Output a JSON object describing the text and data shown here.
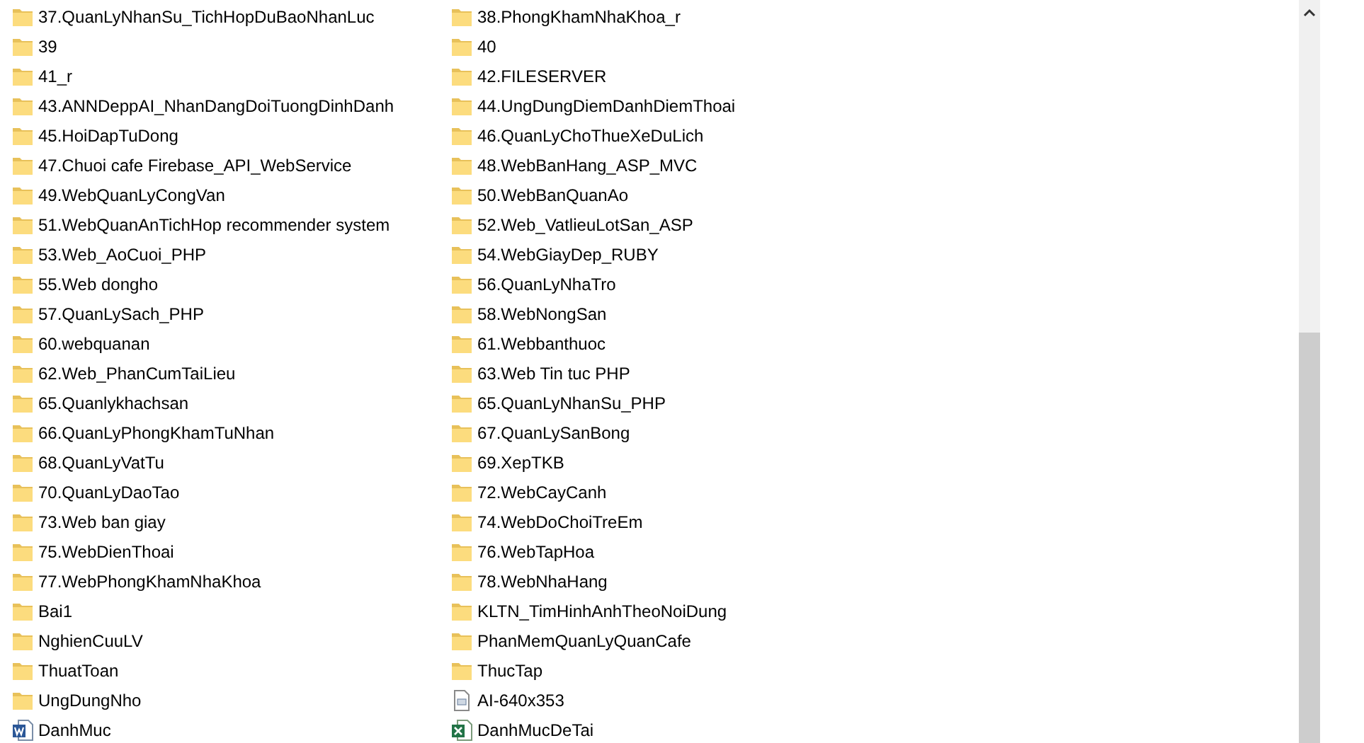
{
  "file_list": [
    {
      "name": "37.QuanLyNhanSu_TichHopDuBaoNhanLuc",
      "kind": "folder"
    },
    {
      "name": "38.PhongKhamNhaKhoa_r",
      "kind": "folder"
    },
    {
      "name": "39",
      "kind": "folder"
    },
    {
      "name": "40",
      "kind": "folder"
    },
    {
      "name": "41_r",
      "kind": "folder"
    },
    {
      "name": "42.FILESERVER",
      "kind": "folder"
    },
    {
      "name": "43.ANNDeppAI_NhanDangDoiTuongDinhDanh",
      "kind": "folder"
    },
    {
      "name": "44.UngDungDiemDanhDiemThoai",
      "kind": "folder"
    },
    {
      "name": "45.HoiDapTuDong",
      "kind": "folder"
    },
    {
      "name": "46.QuanLyChoThueXeDuLich",
      "kind": "folder"
    },
    {
      "name": "47.Chuoi cafe Firebase_API_WebService",
      "kind": "folder"
    },
    {
      "name": "48.WebBanHang_ASP_MVC",
      "kind": "folder"
    },
    {
      "name": "49.WebQuanLyCongVan",
      "kind": "folder"
    },
    {
      "name": "50.WebBanQuanAo",
      "kind": "folder"
    },
    {
      "name": "51.WebQuanAnTichHop recommender system",
      "kind": "folder"
    },
    {
      "name": "52.Web_VatlieuLotSan_ASP",
      "kind": "folder"
    },
    {
      "name": "53.Web_AoCuoi_PHP",
      "kind": "folder"
    },
    {
      "name": "54.WebGiayDep_RUBY",
      "kind": "folder"
    },
    {
      "name": "55.Web dongho",
      "kind": "folder"
    },
    {
      "name": "56.QuanLyNhaTro",
      "kind": "folder"
    },
    {
      "name": "57.QuanLySach_PHP",
      "kind": "folder"
    },
    {
      "name": "58.WebNongSan",
      "kind": "folder"
    },
    {
      "name": "60.webquanan",
      "kind": "folder"
    },
    {
      "name": "61.Webbanthuoc",
      "kind": "folder"
    },
    {
      "name": "62.Web_PhanCumTaiLieu",
      "kind": "folder"
    },
    {
      "name": "63.Web Tin tuc PHP",
      "kind": "folder"
    },
    {
      "name": "65.Quanlykhachsan",
      "kind": "folder"
    },
    {
      "name": "65.QuanLyNhanSu_PHP",
      "kind": "folder"
    },
    {
      "name": "66.QuanLyPhongKhamTuNhan",
      "kind": "folder"
    },
    {
      "name": "67.QuanLySanBong",
      "kind": "folder"
    },
    {
      "name": "68.QuanLyVatTu",
      "kind": "folder"
    },
    {
      "name": "69.XepTKB",
      "kind": "folder"
    },
    {
      "name": "70.QuanLyDaoTao",
      "kind": "folder"
    },
    {
      "name": "72.WebCayCanh",
      "kind": "folder"
    },
    {
      "name": "73.Web ban giay",
      "kind": "folder"
    },
    {
      "name": "74.WebDoChoiTreEm",
      "kind": "folder"
    },
    {
      "name": "75.WebDienThoai",
      "kind": "folder"
    },
    {
      "name": "76.WebTapHoa",
      "kind": "folder"
    },
    {
      "name": "77.WebPhongKhamNhaKhoa",
      "kind": "folder"
    },
    {
      "name": "78.WebNhaHang",
      "kind": "folder"
    },
    {
      "name": "Bai1",
      "kind": "folder"
    },
    {
      "name": "KLTN_TimHinhAnhTheoNoiDung",
      "kind": "folder"
    },
    {
      "name": "NghienCuuLV",
      "kind": "folder"
    },
    {
      "name": "PhanMemQuanLyQuanCafe",
      "kind": "folder"
    },
    {
      "name": "ThuatToan",
      "kind": "folder"
    },
    {
      "name": "ThucTap",
      "kind": "folder"
    },
    {
      "name": "UngDungNho",
      "kind": "folder"
    },
    {
      "name": "AI-640x353",
      "kind": "image"
    },
    {
      "name": "DanhMuc",
      "kind": "word"
    },
    {
      "name": "DanhMucDeTai",
      "kind": "excel"
    }
  ]
}
